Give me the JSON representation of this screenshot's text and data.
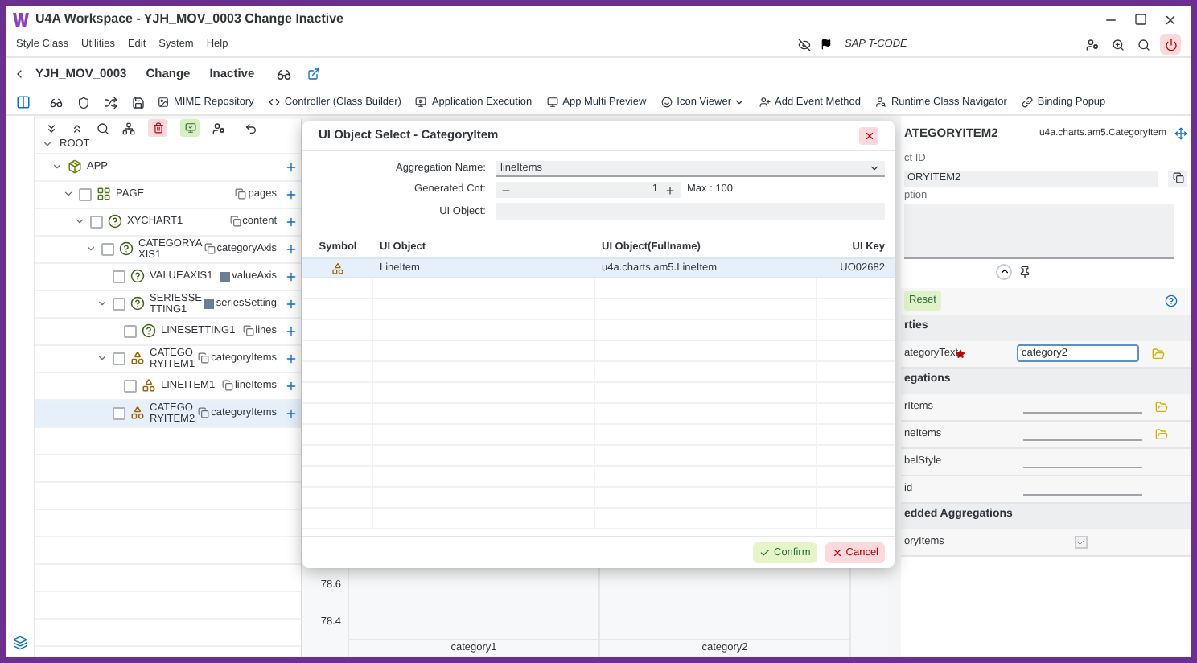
{
  "window": {
    "title": "U4A Workspace - YJH_MOV_0003 Change Inactive"
  },
  "menu": [
    "Style Class",
    "Utilities",
    "Edit",
    "System",
    "Help"
  ],
  "tcode": "SAP T-CODE",
  "header": {
    "app_id": "YJH_MOV_0003",
    "mode": "Change",
    "status": "Inactive"
  },
  "toolbar": [
    {
      "label": "MIME Repository",
      "has_menu": false
    },
    {
      "label": "Controller (Class Builder)",
      "has_menu": false
    },
    {
      "label": "Application Execution",
      "has_menu": false
    },
    {
      "label": "App Multi Preview",
      "has_menu": false
    },
    {
      "label": "Icon Viewer",
      "has_menu": true
    },
    {
      "label": "Add Event Method",
      "has_menu": false
    },
    {
      "label": "Runtime Class Navigator",
      "has_menu": false
    },
    {
      "label": "Binding Popup",
      "has_menu": false
    }
  ],
  "tree": {
    "root": "ROOT",
    "root_expanded": true,
    "nodes": [
      {
        "name": "APP",
        "kind": "app",
        "expanded": true,
        "selected": false,
        "children": [
          {
            "name": "PAGE",
            "kind": "page",
            "checked": false,
            "aggregation": {
              "label": "pages",
              "kind": "list"
            },
            "expanded": true,
            "selected": false,
            "children": [
              {
                "name": "XYCHART1",
                "kind": "unknown",
                "checked": false,
                "aggregation": {
                  "label": "content",
                  "kind": "list"
                },
                "expanded": true,
                "selected": false,
                "children": [
                  {
                    "name": "CATEGORYAXIS1",
                    "kind": "unknown",
                    "checked": false,
                    "aggregation": {
                      "label": "categoryAxis",
                      "kind": "list"
                    },
                    "expanded": true,
                    "selected": false,
                    "children": [
                      {
                        "name": "VALUEAXIS1",
                        "kind": "unknown",
                        "checked": false,
                        "aggregation": {
                          "label": "valueAxis",
                          "kind": "single"
                        },
                        "selected": false
                      },
                      {
                        "name": "SERIESSETTING1",
                        "kind": "unknown",
                        "checked": false,
                        "aggregation": {
                          "label": "seriesSetting",
                          "kind": "single"
                        },
                        "expanded": true,
                        "selected": false,
                        "children": [
                          {
                            "name": "LINESETTING1",
                            "kind": "unknown",
                            "checked": false,
                            "aggregation": {
                              "label": "lines",
                              "kind": "list"
                            },
                            "selected": false
                          }
                        ]
                      },
                      {
                        "name": "CATEGORYITEM1",
                        "kind": "item",
                        "checked": false,
                        "aggregation": {
                          "label": "categoryItems",
                          "kind": "list"
                        },
                        "expanded": true,
                        "selected": false,
                        "children": [
                          {
                            "name": "LINEITEM1",
                            "kind": "item",
                            "checked": false,
                            "aggregation": {
                              "label": "lineItems",
                              "kind": "list"
                            },
                            "selected": false
                          }
                        ]
                      },
                      {
                        "name": "CATEGORYITEM2",
                        "kind": "item",
                        "checked": false,
                        "aggregation": {
                          "label": "categoryItems",
                          "kind": "list"
                        },
                        "selected": true
                      }
                    ]
                  }
                ]
              }
            ]
          }
        ]
      }
    ]
  },
  "chart": {
    "y_labels": [
      "78.6",
      "78.4"
    ],
    "x_labels": [
      "category1",
      "category2"
    ]
  },
  "properties": {
    "title": "ATEGORYITEM2",
    "class": "u4a.charts.am5.CategoryItem",
    "id_label": "ct ID",
    "id_value": "ORYITEM2",
    "desc_label": "ption",
    "reset": "Reset",
    "rows": [
      {
        "kind": "section",
        "label": "rties"
      },
      {
        "kind": "input",
        "label": "ategoryText",
        "required": true,
        "value": "category2"
      },
      {
        "kind": "section",
        "label": "egations"
      },
      {
        "kind": "binding",
        "label": "rItems",
        "folder": true
      },
      {
        "kind": "binding",
        "label": "neItems",
        "folder": true
      },
      {
        "kind": "binding",
        "label": "belStyle",
        "folder": false
      },
      {
        "kind": "binding",
        "label": "id",
        "folder": false
      },
      {
        "kind": "section",
        "label": "edded Aggregations"
      },
      {
        "kind": "check",
        "label": "oryItems",
        "checked": true
      }
    ]
  },
  "dialog": {
    "title": "UI Object Select - CategoryItem",
    "aggregation_label": "Aggregation Name:",
    "aggregation_value": "lineItems",
    "count_label": "Generated Cnt:",
    "count_value": "1",
    "max": "Max : 100",
    "object_label": "UI Object:",
    "columns": [
      "Symbol",
      "UI Object",
      "UI Object(Fullname)",
      "UI Key"
    ],
    "rows": [
      {
        "object": "LineItem",
        "fullname": "u4a.charts.am5.LineItem",
        "key": "UO02682",
        "selected": true
      }
    ],
    "confirm": "Confirm",
    "cancel": "Cancel"
  }
}
